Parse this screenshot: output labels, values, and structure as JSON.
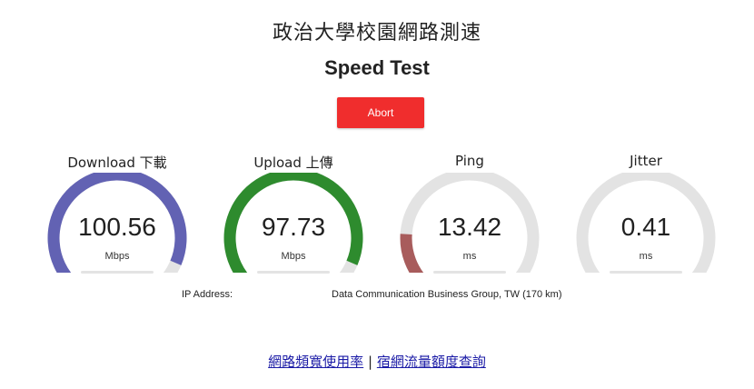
{
  "header": {
    "site_title": "政治大學校園網路測速",
    "test_title": "Speed Test"
  },
  "controls": {
    "abort_label": "Abort"
  },
  "gauges": [
    {
      "label": "Download 下載",
      "value": "100.56",
      "unit": "Mbps",
      "fill_fraction": 1.0,
      "color": "#6262b3"
    },
    {
      "label": "Upload 上傳",
      "value": "97.73",
      "unit": "Mbps",
      "fill_fraction": 1.0,
      "color": "#2e8b2e"
    },
    {
      "label": "Ping",
      "value": "13.42",
      "unit": "ms",
      "fill_fraction": 0.18,
      "color": "#a85c5c"
    },
    {
      "label": "Jitter",
      "value": "0.41",
      "unit": "ms",
      "fill_fraction": 0.03,
      "color": "#a85c5c"
    }
  ],
  "track_color": "#e3e3e3",
  "info": {
    "ip_label": "IP Address:",
    "isp": "Data Communication Business Group, TW (170 km)"
  },
  "links": {
    "bandwidth_usage": "網路頻寬使用率",
    "separator": "|",
    "dorm_quota": "宿網流量額度查詢"
  }
}
